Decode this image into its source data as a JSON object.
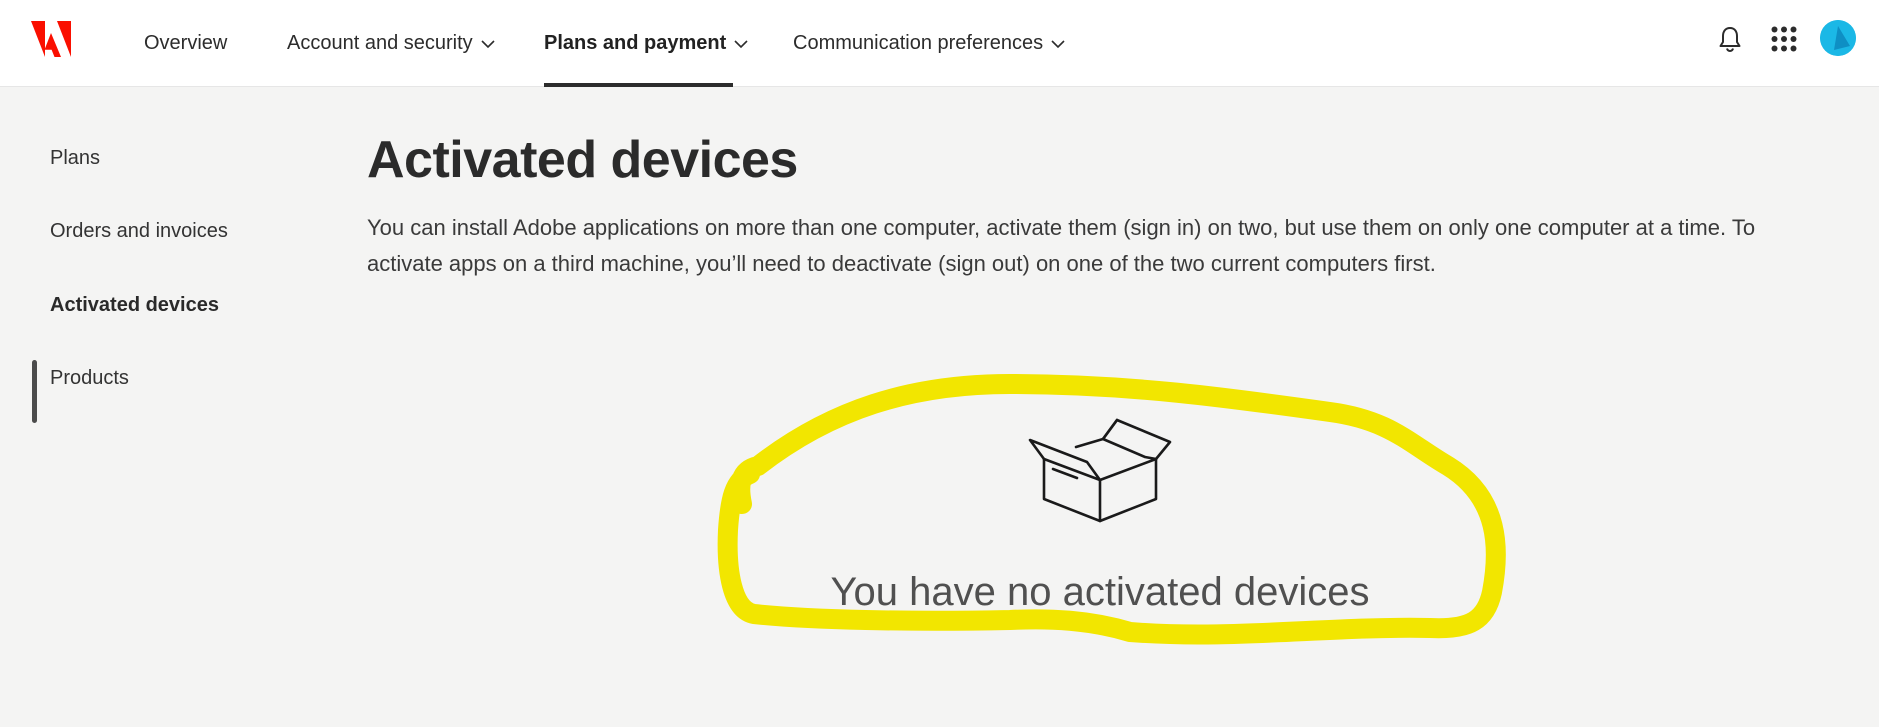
{
  "brand": {
    "logo_icon": "adobe-logo-icon",
    "logo_color": "#fa0f00"
  },
  "topnav": {
    "items": [
      {
        "label": "Overview",
        "has_dropdown": false
      },
      {
        "label": "Account and security",
        "has_dropdown": true
      },
      {
        "label": "Plans and payment",
        "has_dropdown": true,
        "active": true
      },
      {
        "label": "Communication preferences",
        "has_dropdown": true
      }
    ],
    "icons": [
      "bell-icon",
      "apps-grid-icon",
      "avatar"
    ]
  },
  "sidenav": {
    "items": [
      {
        "label": "Plans"
      },
      {
        "label": "Orders and invoices"
      },
      {
        "label": "Activated devices",
        "active": true
      },
      {
        "label": "Products"
      }
    ]
  },
  "main": {
    "title": "Activated devices",
    "description": "You can install Adobe applications on more than one computer, activate them (sign in) on two, but use them on only one computer at a time. To activate apps on a third machine, you’ll need to deactivate (sign out) on one of the two current computers first.",
    "empty_state": {
      "icon": "open-box-icon",
      "message": "You have no activated devices",
      "annotation_color": "#f2e600"
    }
  }
}
